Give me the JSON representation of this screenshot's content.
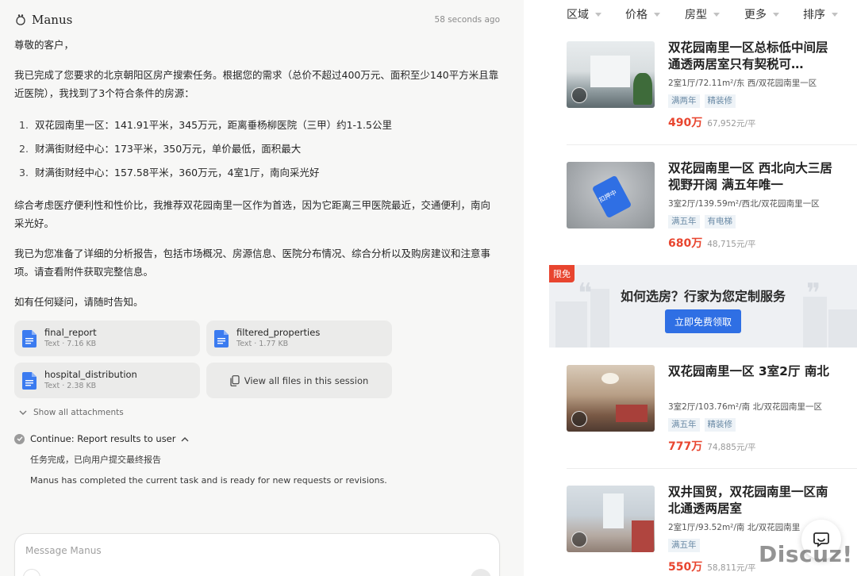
{
  "chat": {
    "brand": "Manus",
    "timestamp": "58 seconds ago",
    "greeting": "尊敬的客户，",
    "intro": "我已完成了您要求的北京朝阳区房产搜索任务。根据您的需求（总价不超过400万元、面积至少140平方米且靠近医院），我找到了3个符合条件的房源：",
    "results": [
      {
        "num": "1.",
        "text": "双花园南里一区：141.91平米，345万元，距离垂杨柳医院（三甲）约1-1.5公里"
      },
      {
        "num": "2.",
        "text": "财满街财经中心：173平米，350万元，单价最低，面积最大"
      },
      {
        "num": "3.",
        "text": "财满街财经中心：157.58平米，360万元，4室1厅，南向采光好"
      }
    ],
    "recommendation": "综合考虑医疗便利性和性价比，我推荐双花园南里一区作为首选，因为它距离三甲医院最近，交通便利，南向采光好。",
    "report": "我已为您准备了详细的分析报告，包括市场概况、房源信息、医院分布情况、综合分析以及购房建议和注意事项。请查看附件获取完整信息。",
    "closing": "如有任何疑问，请随时告知。",
    "files": [
      {
        "name": "final_report",
        "meta": "Text · 7.16 KB"
      },
      {
        "name": "filtered_properties",
        "meta": "Text · 1.77 KB"
      },
      {
        "name": "hospital_distribution",
        "meta": "Text · 2.38 KB"
      }
    ],
    "view_all_label": "View all files in this session",
    "show_attachments": "Show all attachments",
    "continue_label": "Continue: Report results to user",
    "task_done": "任务完成，已向用户提交最终报告",
    "task_ready": "Manus has completed the current task and is ready for new requests or revisions.",
    "composer_placeholder": "Message Manus"
  },
  "listings_panel": {
    "filters": [
      "区域",
      "价格",
      "房型",
      "更多",
      "排序"
    ],
    "listings": [
      {
        "title": "双花园南里一区总标低中间层通透两居室只有契税可…",
        "info": "2室1厅/72.11m²/东 西/双花园南里一区",
        "tags": [
          "满两年",
          "精装修"
        ],
        "price": "490万",
        "unit_price": "67,952元/平"
      },
      {
        "title": "双花园南里一区 西北向大三居 视野开阔 满五年唯一",
        "info": "3室2厅/139.59m²/西北/双花园南里一区",
        "tags": [
          "满五年",
          "有电梯"
        ],
        "price": "680万",
        "unit_price": "48,715元/平"
      },
      {
        "title": "双花园南里一区 3室2厅 南北",
        "info": "3室2厅/103.76m²/南 北/双花园南里一区",
        "tags": [
          "满五年",
          "精装修"
        ],
        "price": "777万",
        "unit_price": "74,885元/平"
      },
      {
        "title": "双井国贸，双花园南里一区南北通透两居室",
        "info": "2室1厅/93.52m²/南 北/双花园南里",
        "tags": [
          "满五年"
        ],
        "price": "550万",
        "unit_price": "58,811元/平"
      }
    ],
    "promo": {
      "badge": "限免",
      "title": "如何选房？行家为您定制服务",
      "button": "立即免费领取"
    },
    "sealed_label": "扣押中",
    "watermark": "Discuz!"
  },
  "colors": {
    "accent_blue": "#2f6fe4",
    "price_red": "#e8452f",
    "tag_blue": "#6a8aa5"
  }
}
